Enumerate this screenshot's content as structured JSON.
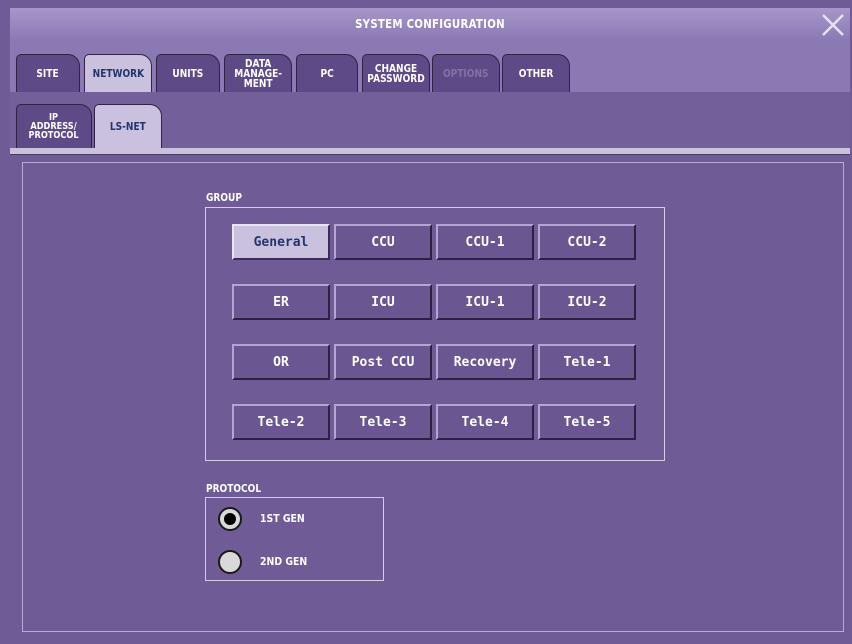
{
  "window": {
    "title": "SYSTEM CONFIGURATION"
  },
  "tabs": [
    {
      "label": "SITE",
      "state": "normal"
    },
    {
      "label": "NETWORK",
      "state": "active"
    },
    {
      "label": "UNITS",
      "state": "normal"
    },
    {
      "label": "DATA\nMANAGE-\nMENT",
      "state": "normal"
    },
    {
      "label": "PC",
      "state": "normal"
    },
    {
      "label": "CHANGE\nPASSWORD",
      "state": "normal"
    },
    {
      "label": "OPTIONS",
      "state": "disabled"
    },
    {
      "label": "OTHER",
      "state": "normal"
    }
  ],
  "subtabs": [
    {
      "label": "IP\nADDRESS/\nPROTOCOL",
      "state": "normal"
    },
    {
      "label": "LS-NET",
      "state": "active"
    }
  ],
  "group": {
    "label": "GROUP",
    "selected": "General",
    "buttons": [
      "General",
      "CCU",
      "CCU-1",
      "CCU-2",
      "ER",
      "ICU",
      "ICU-1",
      "ICU-2",
      "OR",
      "Post CCU",
      "Recovery",
      "Tele-1",
      "Tele-2",
      "Tele-3",
      "Tele-4",
      "Tele-5"
    ]
  },
  "protocol": {
    "label": "PROTOCOL",
    "options": [
      {
        "label": "1ST GEN",
        "checked": true
      },
      {
        "label": "2ND GEN",
        "checked": false
      }
    ]
  },
  "icons": {
    "close": "close-icon"
  },
  "colors": {
    "background": "#6f5c96",
    "selected": "#c9c1de",
    "selected_text": "#23346d"
  }
}
